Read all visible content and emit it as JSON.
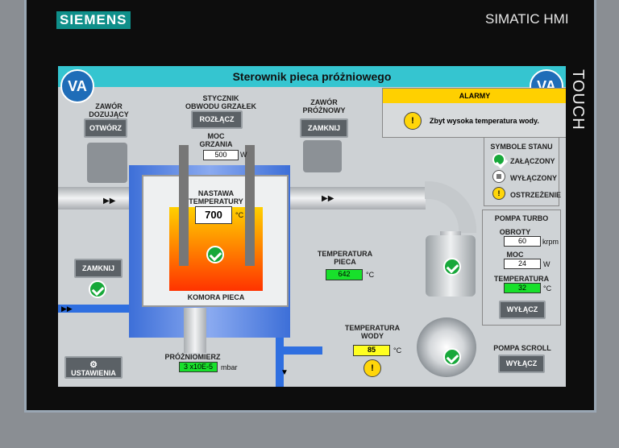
{
  "device": {
    "brand": "SIEMENS",
    "model": "SIMATIC HMI",
    "touch": "TOUCH"
  },
  "screen": {
    "title": "Sterownik pieca próżniowego",
    "logo_text": "VA"
  },
  "valve_dosing": {
    "label_line1": "ZAWÓR",
    "label_line2": "DOZUJĄCY",
    "button": "OTWÓRZ"
  },
  "contactor": {
    "label_line1": "STYCZNIK",
    "label_line2": "OBWODU GRZAŁEK",
    "button": "ROZŁĄCZ"
  },
  "heating_power": {
    "label_line1": "MOC",
    "label_line2": "GRZANIA",
    "value": "500",
    "unit": "W"
  },
  "valve_empty": {
    "label_line1": "ZAWÓR",
    "label_line2": "PRÓŻNOWY",
    "button": "ZAMKNIJ"
  },
  "setpoint": {
    "label_line1": "NASTAWA",
    "label_line2": "TEMPERATURY",
    "value": "700",
    "unit": "°C"
  },
  "chamber_label": "KOMORA PIECA",
  "furnace_temp": {
    "label_line1": "TEMPERATURA",
    "label_line2": "PIECA",
    "value": "642",
    "unit": "°C"
  },
  "left_valve_button": "ZAMKNIJ",
  "vacuum_gauge": {
    "label": "PRÓŻNIOMIERZ",
    "value": "3 x10E-5",
    "unit": "mbar"
  },
  "water_temp": {
    "label_line1": "TEMPERATURA",
    "label_line2": "WODY",
    "value": "85",
    "unit": "°C"
  },
  "settings_button": "USTAWIENIA",
  "alarms": {
    "header": "ALARMY",
    "message": "Zbyt wysoka temperatura wody."
  },
  "legend": {
    "title": "SYMBOLE STANU",
    "on": "ZAŁĄCZONY",
    "off": "WYŁĄCZONY",
    "warning": "OSTRZEŻENIE"
  },
  "turbo_pump": {
    "title": "POMPA TURBO",
    "speed_label": "OBROTY",
    "speed_value": "60",
    "speed_unit": "krpm",
    "power_label": "MOC",
    "power_value": "24",
    "power_unit": "W",
    "temp_label": "TEMPERATURA",
    "temp_value": "32",
    "temp_unit": "°C",
    "button": "WYŁĄCZ"
  },
  "scroll_pump": {
    "title": "POMPA SCROLL",
    "button": "WYŁĄCZ"
  },
  "colors": {
    "accent": "#35c5d0",
    "brand": "#0f8f8a",
    "ok": "#17a83a",
    "warn": "#ffd60a",
    "alarm_bar": "#ffd000"
  }
}
